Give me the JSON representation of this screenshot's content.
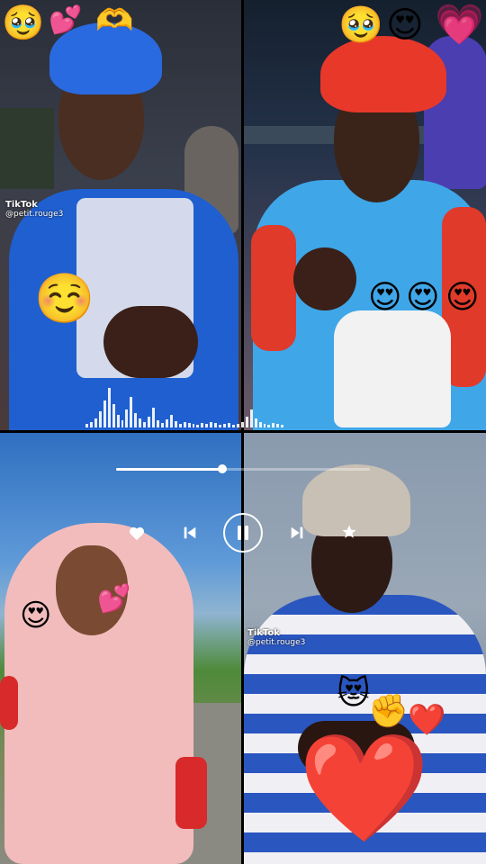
{
  "watermarks": [
    {
      "brand": "TikTok",
      "handle": "@petit.rouge3"
    },
    {
      "brand": "TikTok",
      "handle": "@petit.rouge3"
    }
  ],
  "emojis": {
    "tl_top": [
      "🥹",
      "💕",
      "🫶"
    ],
    "tr_top": [
      "🥹",
      "😍",
      "💗"
    ],
    "tl_mid": "☺️",
    "tr_mid": [
      "😍",
      "😍",
      "😍"
    ],
    "bl_left": "😍",
    "bl_right": "💕",
    "br_face": "😻",
    "br_hand": "✊",
    "br_small_heart": "❤️",
    "br_big_heart": "❤️"
  },
  "player": {
    "progress": 0.42,
    "icons": [
      "heart-icon",
      "previous-icon",
      "pause-icon",
      "next-icon",
      "star-icon"
    ]
  },
  "colors": {
    "blue_outfit": "#1f5fd0",
    "red_scarf": "#e8382a",
    "pink_hijab": "#f3c0c0",
    "striped_shirt": "#2a56c0"
  }
}
